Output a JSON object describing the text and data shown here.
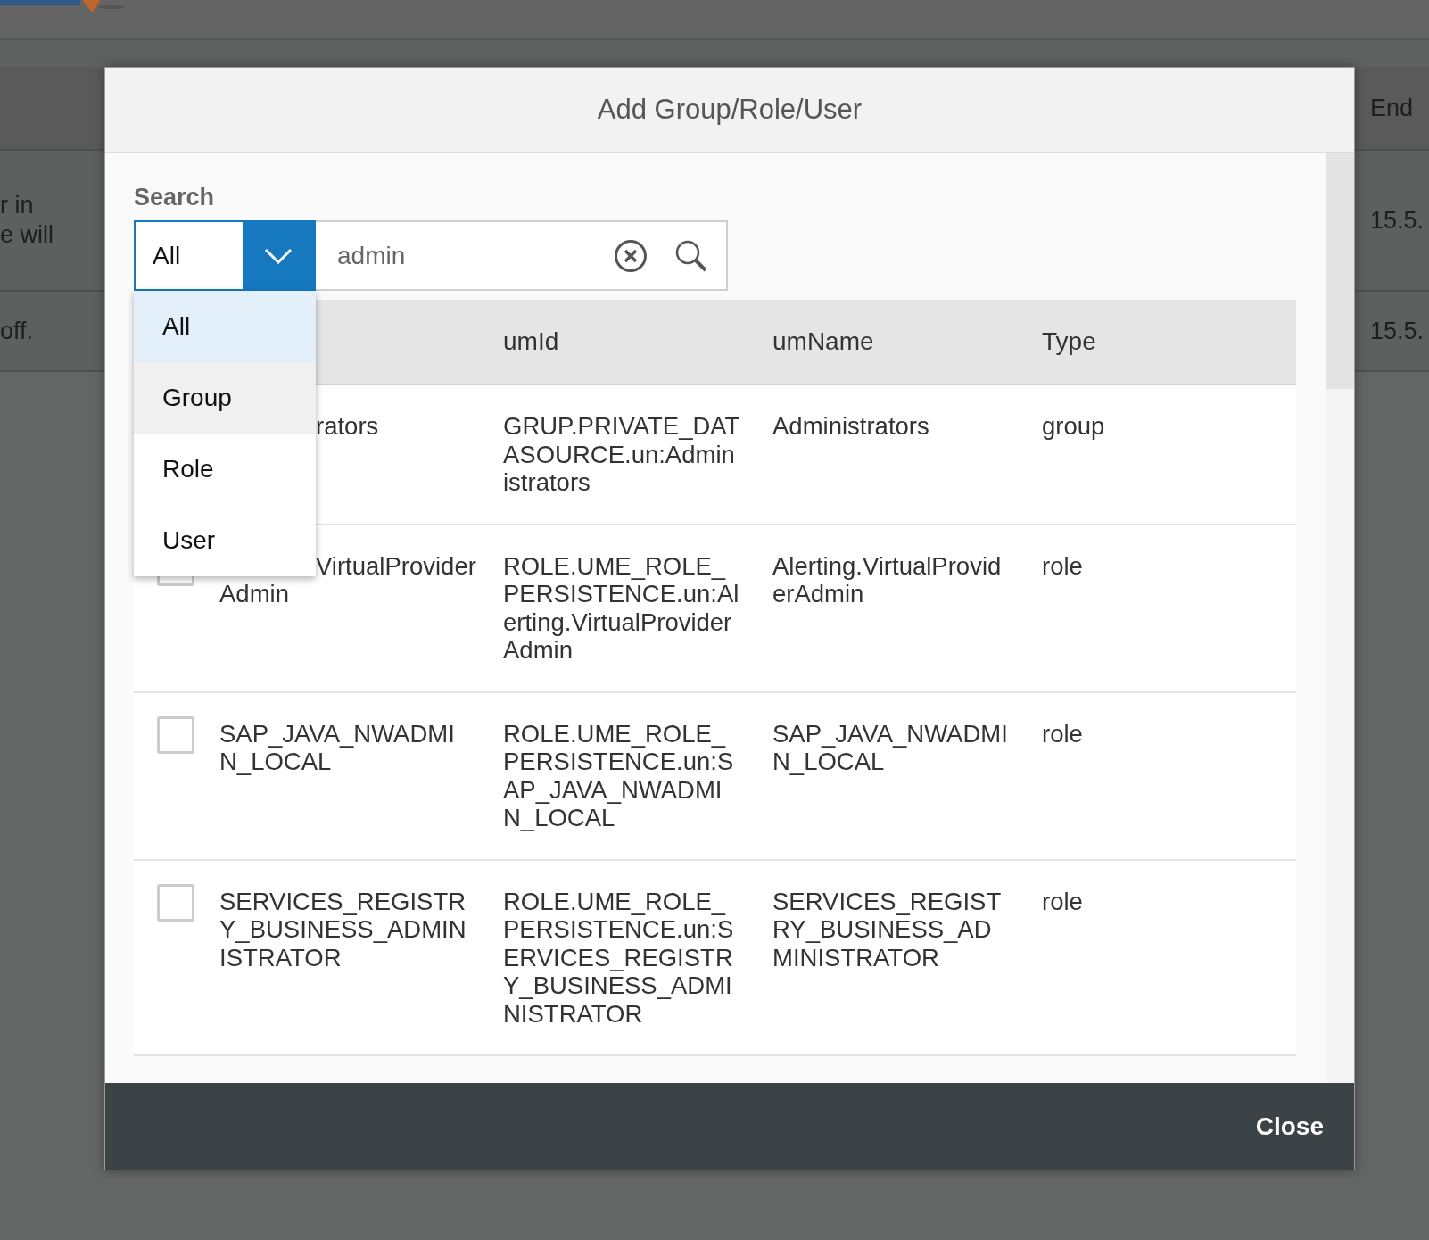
{
  "background": {
    "header": {
      "label": "End"
    },
    "rows": [
      {
        "lines": [
          "r in",
          "e will"
        ],
        "date": "15.5."
      },
      {
        "lines": [
          "off."
        ],
        "date": "15.5."
      }
    ]
  },
  "dialog": {
    "title": "Add Group/Role/User",
    "search": {
      "label": "Search",
      "scope": "All",
      "value": "admin",
      "dropdown_open": true,
      "options": [
        {
          "label": "All",
          "selected": true,
          "hovered": false
        },
        {
          "label": "Group",
          "selected": false,
          "hovered": true
        },
        {
          "label": "Role",
          "selected": false,
          "hovered": false
        },
        {
          "label": "User",
          "selected": false,
          "hovered": false
        }
      ]
    },
    "table": {
      "columns": [
        "umId",
        "umName",
        "Type"
      ],
      "rows": [
        {
          "name": [
            "rators"
          ],
          "name_covered": true,
          "umId": [
            "GRUP.PRIVATE_DAT",
            "ASOURCE.un:Admin",
            "istrators"
          ],
          "umName": [
            "Administrators"
          ],
          "type": "group"
        },
        {
          "checked": false,
          "name": [
            "VirtualProvider",
            "Admin"
          ],
          "name_covered": true,
          "umId": [
            "ROLE.UME_ROLE_",
            "PERSISTENCE.un:Al",
            "erting.VirtualProvider",
            "Admin"
          ],
          "umName": [
            "Alerting.VirtualProvid",
            "erAdmin"
          ],
          "type": "role"
        },
        {
          "checked": false,
          "name": [
            "SAP_JAVA_NWADMI",
            "N_LOCAL"
          ],
          "name_covered": false,
          "umId": [
            "ROLE.UME_ROLE_",
            "PERSISTENCE.un:S",
            "AP_JAVA_NWADMI",
            "N_LOCAL"
          ],
          "umName": [
            "SAP_JAVA_NWADMI",
            "N_LOCAL"
          ],
          "type": "role"
        },
        {
          "checked": false,
          "name": [
            "SERVICES_REGISTR",
            "Y_BUSINESS_ADMIN",
            "ISTRATOR"
          ],
          "name_covered": false,
          "umId": [
            "ROLE.UME_ROLE_",
            "PERSISTENCE.un:S",
            "ERVICES_REGISTR",
            "Y_BUSINESS_ADMI",
            "NISTRATOR"
          ],
          "umName": [
            "SERVICES_REGIST",
            "RY_BUSINESS_AD",
            "MINISTRATOR"
          ],
          "type": "role"
        }
      ]
    },
    "footer": {
      "close": "Close"
    }
  }
}
